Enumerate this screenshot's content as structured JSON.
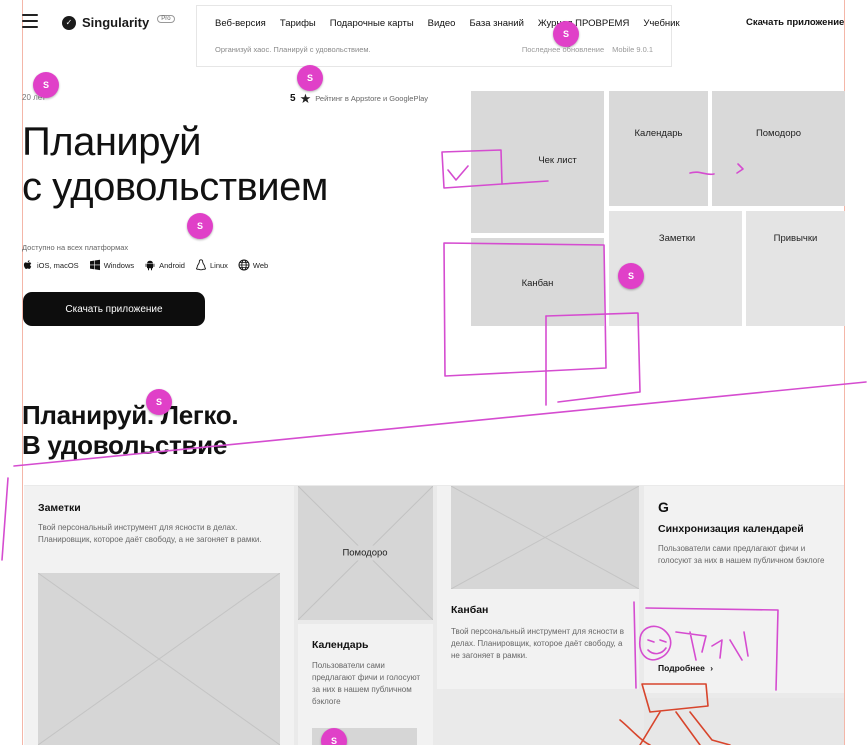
{
  "header": {
    "logo_text": "Singularity",
    "logo_badge": "Pro",
    "nav": [
      "Веб-версия",
      "Тарифы",
      "Подарочные карты",
      "Видео",
      "База знаний",
      "Журнал ПРОВРЕМЯ",
      "Учебник"
    ],
    "tagline": "Организуй хаос. Планируй с удовольствием.",
    "update_label": "Последнее обновление",
    "update_version": "Mobile 9.0.1",
    "download": "Скачать приложение"
  },
  "hero": {
    "year": "20 лет",
    "rating_value": "5",
    "rating_text": "Рейтинг в Appstore и GooglePlay",
    "title": "Планируй\nс удовольствием",
    "available": "Доступно на всех платформах",
    "platforms": [
      {
        "icon": "apple-icon",
        "label": "iOS, macOS"
      },
      {
        "icon": "windows-icon",
        "label": "Windows"
      },
      {
        "icon": "android-icon",
        "label": "Android"
      },
      {
        "icon": "linux-icon",
        "label": "Linux"
      },
      {
        "icon": "globe-icon",
        "label": "Web"
      }
    ],
    "cta": "Скачать приложение",
    "tiles": {
      "checklist": "Чек лист",
      "calendar": "Календарь",
      "pomodoro": "Помодоро",
      "kanban": "Канбан",
      "notes": "Заметки",
      "habits": "Привычки"
    }
  },
  "features": {
    "title": "Планируй. Легко.\nВ удовольствие",
    "notes": {
      "title": "Заметки",
      "text": "Твой персональный инструмент для ясности в делах. Планировщик, которое даёт свободу, а не загоняет в рамки."
    },
    "pomodoro": {
      "label": "Помодоро"
    },
    "calendar": {
      "title": "Календарь",
      "text": "Пользователи сами предлагают фичи и голосуют за них в нашем публичном бэклоге"
    },
    "kanban": {
      "title": "Канбан",
      "text": "Твой персональный инструмент для ясности в делах. Планировщик, которое даёт свободу, а не загоняет в рамки."
    },
    "sync": {
      "icon": "G",
      "title": "Синхронизация календарей",
      "text": "Пользователи сами предлагают фичи и голосуют за них в нашем публичном бэклоге",
      "more": "Подробнее"
    }
  },
  "markers": {
    "label": "S"
  },
  "colors": {
    "marker": "#e040c8",
    "sketch": "#d54cd0",
    "guide": "#f4b6a8",
    "cta": "#0d0d0d"
  }
}
